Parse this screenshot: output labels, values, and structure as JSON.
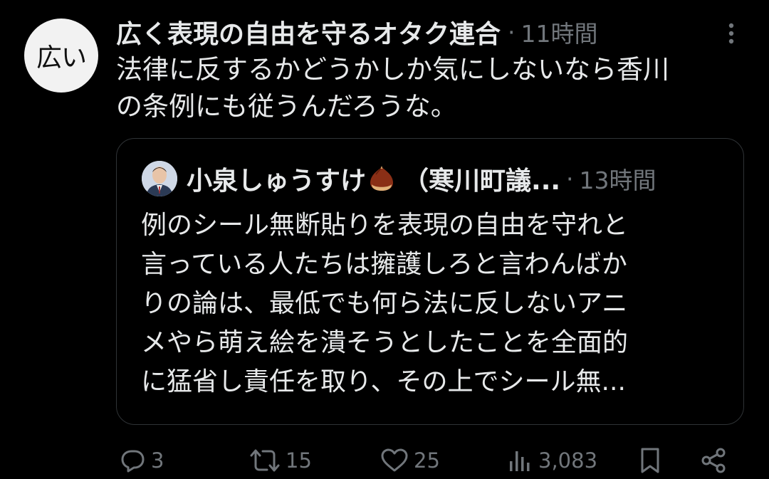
{
  "tweet": {
    "avatar_text": "広い",
    "author_name": "広く表現の自由を守るオタク連合",
    "separator": "·",
    "time": "11時間",
    "more_icon": "more-vertical-icon",
    "text": "法律に反するかどうかしか気にしないなら香川\nの条例にも従うんだろうな。"
  },
  "quote": {
    "author_name": "小泉しゅうすけ",
    "emoji": "chestnut-emoji",
    "affiliation": "（寒川町議...",
    "separator": "·",
    "time": "13時間",
    "text": "例のシール無断貼りを表現の自由を守れと\n言っている人たちは擁護しろと言わんばか\nりの論は、最低でも何ら法に反しないアニ\nメやら萌え絵を潰そうとしたことを全面的\nに猛省し責任を取り、その上でシール無..."
  },
  "actions": {
    "reply": {
      "icon": "reply-icon",
      "count": "3"
    },
    "retweet": {
      "icon": "retweet-icon",
      "count": "15"
    },
    "like": {
      "icon": "heart-icon",
      "count": "25"
    },
    "views": {
      "icon": "views-icon",
      "count": "3,083"
    },
    "bookmark": {
      "icon": "bookmark-icon"
    },
    "share": {
      "icon": "share-icon"
    }
  },
  "colors": {
    "background": "#000000",
    "text_primary": "#e7e9ea",
    "text_secondary": "#71767b",
    "border": "#2f3336"
  }
}
